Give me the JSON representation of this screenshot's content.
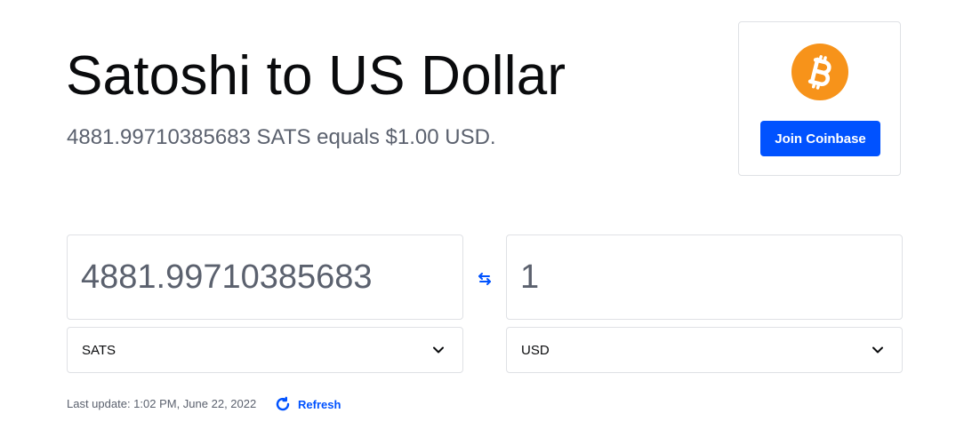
{
  "header": {
    "title": "Satoshi to US Dollar",
    "subtitle": "4881.99710385683 SATS equals $1.00 USD."
  },
  "promo": {
    "coin_icon": "bitcoin-icon",
    "button_label": "Join Coinbase"
  },
  "converter": {
    "from_amount": "4881.99710385683",
    "to_amount": "1",
    "from_currency": "SATS",
    "to_currency": "USD",
    "swap_icon": "swap-arrows-icon"
  },
  "footer": {
    "last_update": "Last update: 1:02 PM, June 22, 2022",
    "refresh_label": "Refresh"
  },
  "colors": {
    "accent": "#0052ff",
    "bitcoin": "#f7931a",
    "muted_text": "#5b616e",
    "border": "#dfe1e5"
  }
}
